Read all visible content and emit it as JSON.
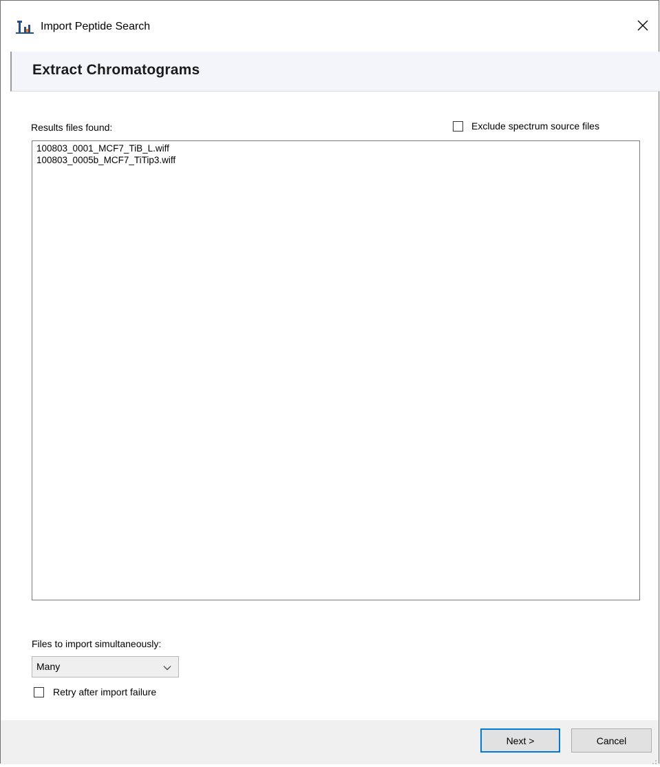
{
  "window": {
    "title": "Import Peptide Search",
    "icon": "skyline-app-icon",
    "close_icon": "close-icon"
  },
  "header": {
    "title": "Extract Chromatograms"
  },
  "results": {
    "label": "Results files found:",
    "exclude_label": "Exclude spectrum source files",
    "exclude_checked": false,
    "files": [
      "100803_0001_MCF7_TiB_L.wiff",
      "100803_0005b_MCF7_TiTip3.wiff"
    ]
  },
  "options": {
    "simultaneous_label": "Files to import simultaneously:",
    "simultaneous_value": "Many",
    "retry_label": "Retry after import failure",
    "retry_checked": false
  },
  "footer": {
    "next_label": "Next >",
    "cancel_label": "Cancel"
  },
  "colors": {
    "accent": "#0078d7",
    "header_band": "#f4f5fb",
    "footer": "#f0f0f0"
  }
}
